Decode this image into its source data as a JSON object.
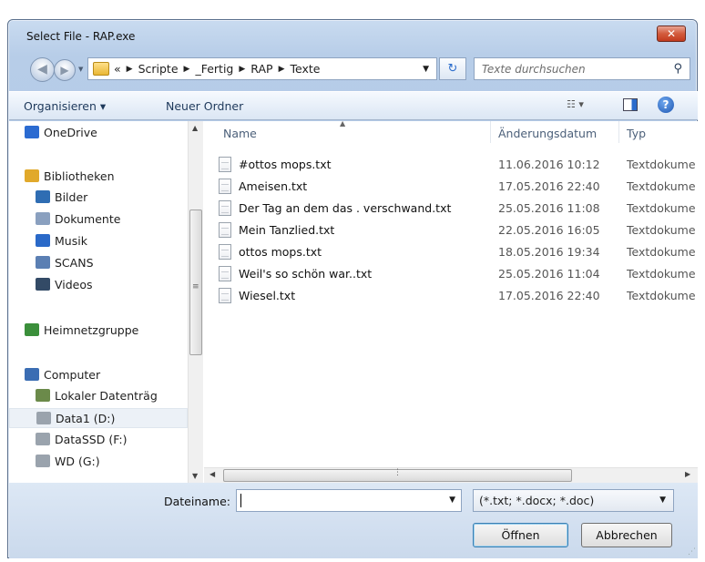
{
  "window": {
    "title": "Select File - RAP.exe",
    "close_label": "✕"
  },
  "address": {
    "overflow": "«",
    "crumbs": [
      "Scripte",
      "_Fertig",
      "RAP",
      "Texte"
    ],
    "search_placeholder": "Texte durchsuchen"
  },
  "toolbar": {
    "organize_label": "Organisieren ▾",
    "new_folder_label": "Neuer Ordner",
    "help_label": "?"
  },
  "nav_pane": {
    "items": [
      {
        "label": "OneDrive",
        "icon": "cloud-icon",
        "color": "#2b6bd1"
      },
      {
        "label": "Bibliotheken",
        "icon": "library-icon",
        "color": "#e1a92b"
      },
      {
        "label": "Bilder",
        "icon": "pictures-icon",
        "color": "#2f6db3"
      },
      {
        "label": "Dokumente",
        "icon": "documents-icon",
        "color": "#8aa0bf"
      },
      {
        "label": "Musik",
        "icon": "music-icon",
        "color": "#2a69c8"
      },
      {
        "label": "SCANS",
        "icon": "scans-icon",
        "color": "#5b7fb3"
      },
      {
        "label": "Videos",
        "icon": "videos-icon",
        "color": "#334a66"
      },
      {
        "label": "Heimnetzgruppe",
        "icon": "homegroup-icon",
        "color": "#3b8f3b"
      },
      {
        "label": "Computer",
        "icon": "computer-icon",
        "color": "#3b6db3"
      },
      {
        "label": "Lokaler Datenträg",
        "icon": "local-disk-icon",
        "color": "#6b8a4a"
      },
      {
        "label": "Data1 (D:)",
        "icon": "drive-icon",
        "color": "#9aa3ad"
      },
      {
        "label": "DataSSD (F:)",
        "icon": "drive-icon",
        "color": "#9aa3ad"
      },
      {
        "label": "WD (G:)",
        "icon": "drive-icon",
        "color": "#9aa3ad"
      }
    ],
    "selected": "Data1 (D:)"
  },
  "file_list": {
    "columns": {
      "name": "Name",
      "date": "Änderungsdatum",
      "type": "Typ"
    },
    "files": [
      {
        "name": "#ottos mops.txt",
        "date": "11.06.2016 10:12",
        "type": "Textdokume"
      },
      {
        "name": "Ameisen.txt",
        "date": "17.05.2016 22:40",
        "type": "Textdokume"
      },
      {
        "name": "Der Tag an dem das . verschwand.txt",
        "date": "25.05.2016 11:08",
        "type": "Textdokume"
      },
      {
        "name": "Mein Tanzlied.txt",
        "date": "22.05.2016 16:05",
        "type": "Textdokume"
      },
      {
        "name": "ottos mops.txt",
        "date": "18.05.2016 19:34",
        "type": "Textdokume"
      },
      {
        "name": "Weil's so schön war..txt",
        "date": "25.05.2016 11:04",
        "type": "Textdokume"
      },
      {
        "name": "Wiesel.txt",
        "date": "17.05.2016 22:40",
        "type": "Textdokume"
      }
    ]
  },
  "footer": {
    "filename_label": "Dateiname:",
    "filename_value": "",
    "filter_value": "(*.txt; *.docx; *.doc)",
    "open_label": "Öffnen",
    "cancel_label": "Abbrechen"
  }
}
